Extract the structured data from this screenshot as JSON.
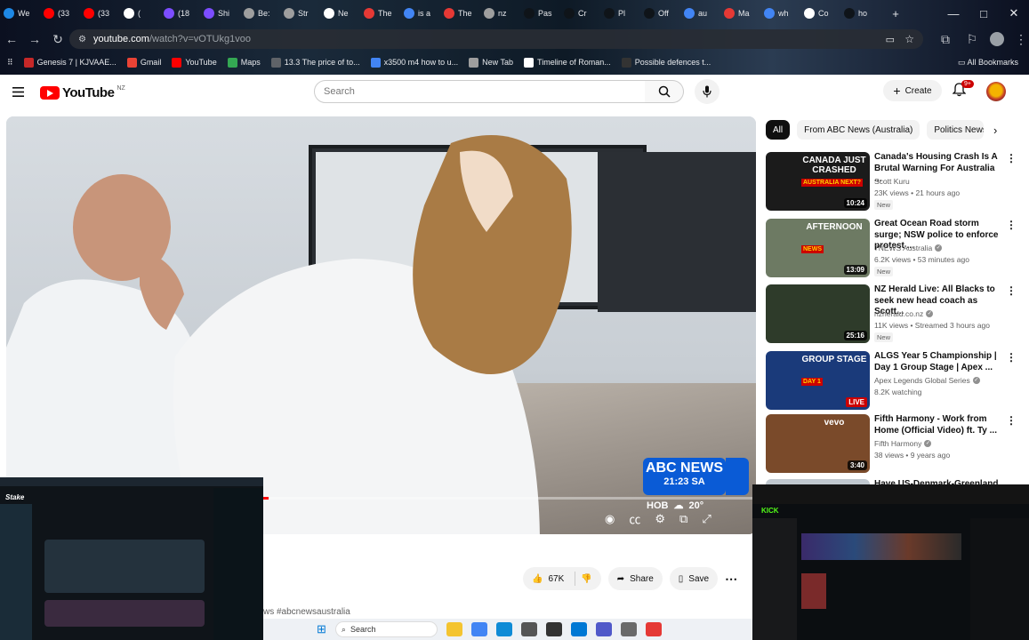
{
  "browser": {
    "tabs": [
      {
        "label": "We",
        "color": "#1e88e5"
      },
      {
        "label": "(33",
        "color": "#ff0000"
      },
      {
        "label": "(33",
        "color": "#ff0000"
      },
      {
        "label": "(",
        "color": "#ffffff"
      },
      {
        "label": "(18",
        "color": "#7c4dff"
      },
      {
        "label": "Shi",
        "color": "#7c4dff"
      },
      {
        "label": "Be:",
        "color": "#9e9e9e"
      },
      {
        "label": "Str",
        "color": "#9e9e9e"
      },
      {
        "label": "Ne",
        "color": "#ffffff"
      },
      {
        "label": "The",
        "color": "#e53935"
      },
      {
        "label": "is a",
        "color": "#4285f4"
      },
      {
        "label": "The",
        "color": "#e53935"
      },
      {
        "label": "nz",
        "color": "#9e9e9e"
      },
      {
        "label": "Pas",
        "color": "#0f1419"
      },
      {
        "label": "Cr",
        "color": "#0f1419"
      },
      {
        "label": "Pl",
        "color": "#0f1419"
      },
      {
        "label": "Off",
        "color": "#0f1419"
      },
      {
        "label": "au",
        "color": "#4285f4"
      },
      {
        "label": "Ma",
        "color": "#e53935"
      },
      {
        "label": "wh",
        "color": "#4285f4"
      },
      {
        "label": "Co",
        "color": "#ffffff"
      },
      {
        "label": "ho",
        "color": "#0f1419"
      }
    ],
    "new_tab_label": "+",
    "window_controls": {
      "minimize": "—",
      "maximize": "□",
      "close": "✕"
    },
    "url_host": "youtube.com",
    "url_path": "/watch?v=vOTUkg1voo",
    "bookmarks": [
      {
        "label": "Genesis 7 | KJVAAE...",
        "color": "#c62828"
      },
      {
        "label": "Gmail",
        "color": "#ea4335"
      },
      {
        "label": "YouTube",
        "color": "#ff0000"
      },
      {
        "label": "Maps",
        "color": "#34a853"
      },
      {
        "label": "13.3 The price of to...",
        "color": "#5f6368"
      },
      {
        "label": "x3500 m4 how to u...",
        "color": "#4285f4"
      },
      {
        "label": "New Tab",
        "color": "#9e9e9e"
      },
      {
        "label": "Timeline of Roman...",
        "color": "#ffffff"
      },
      {
        "label": "Possible defences t...",
        "color": "#333333"
      }
    ],
    "all_bookmarks_label": "All Bookmarks"
  },
  "youtube": {
    "logo_text": "YouTube",
    "country_code": "NZ",
    "search_placeholder": "Search",
    "create_label": "Create",
    "notification_count": "9+",
    "player": {
      "news_brand": "ABC NEWS",
      "news_time": "21:23 SA",
      "weather_city": "HOB",
      "weather_temp": "20°",
      "progress_fraction": 0.35
    },
    "chips": [
      "All",
      "From ABC News (Australia)",
      "Politics News"
    ],
    "recommendations": [
      {
        "title": "Canada's Housing Crash Is A Brutal Warning For Australia ...",
        "channel": "Scott Kuru",
        "verified": false,
        "meta": "23K views • 21 hours ago",
        "badge": "New",
        "duration": "10:24",
        "thumb_text": "CANADA JUST CRASHED",
        "thumb_sub": "AUSTRALIA NEXT?",
        "thumb_color": "#1b1b1b"
      },
      {
        "title": "Great Ocean Road storm surge; NSW police to enforce protest ...",
        "channel": "7NEWS Australia",
        "verified": true,
        "meta": "6.2K views • 53 minutes ago",
        "badge": "New",
        "duration": "13:09",
        "thumb_text": "AFTERNOON",
        "thumb_sub": "NEWS",
        "thumb_color": "#6d7a63"
      },
      {
        "title": "NZ Herald Live: All Blacks to seek new head coach as Scott...",
        "channel": "nzherald.co.nz",
        "verified": true,
        "meta": "11K views • Streamed 3 hours ago",
        "badge": "New",
        "duration": "25:16",
        "thumb_text": "",
        "thumb_sub": "",
        "thumb_color": "#2e3b2a"
      },
      {
        "title": "ALGS Year 5 Championship | Day 1 Group Stage | Apex ...",
        "channel": "Apex Legends Global Series",
        "verified": true,
        "meta": "8.2K watching",
        "badge": "",
        "duration": "LIVE",
        "thumb_text": "GROUP STAGE",
        "thumb_sub": "DAY 1",
        "thumb_color": "#1a3a7a"
      },
      {
        "title": "Fifth Harmony - Work from Home (Official Video) ft. Ty ...",
        "channel": "Fifth Harmony",
        "verified": true,
        "meta": "38 views • 9 years ago",
        "badge": "",
        "duration": "3:40",
        "thumb_text": "vevo",
        "thumb_sub": "",
        "thumb_color": "#7a4a2a"
      },
      {
        "title": "Have US-Denmark-Greenland ...",
        "channel": "",
        "verified": false,
        "meta": "",
        "badge": "",
        "duration": "",
        "thumb_text": "",
        "thumb_sub": "",
        "thumb_color": "#c0c8cf"
      }
    ],
    "actions": {
      "likes": "67K",
      "share_label": "Share",
      "save_label": "Save"
    },
    "hashtags": "ws #abcnewsaustralia"
  },
  "overlays": {
    "left_app": "Stake",
    "right_app": "KICK"
  },
  "taskbar": {
    "search_placeholder": "Search",
    "icons": [
      {
        "name": "file-explorer-icon",
        "color": "#f4c430"
      },
      {
        "name": "chrome-icon",
        "color": "#4285f4"
      },
      {
        "name": "edge-icon",
        "color": "#0f8bd6"
      },
      {
        "name": "task-view-icon",
        "color": "#555555"
      },
      {
        "name": "store-icon",
        "color": "#333333"
      },
      {
        "name": "mail-icon",
        "color": "#0078d4"
      },
      {
        "name": "teams-icon",
        "color": "#5059c9"
      },
      {
        "name": "photos-icon",
        "color": "#6a6a6a"
      },
      {
        "name": "pinned-app-icon",
        "color": "#e53935"
      }
    ]
  }
}
